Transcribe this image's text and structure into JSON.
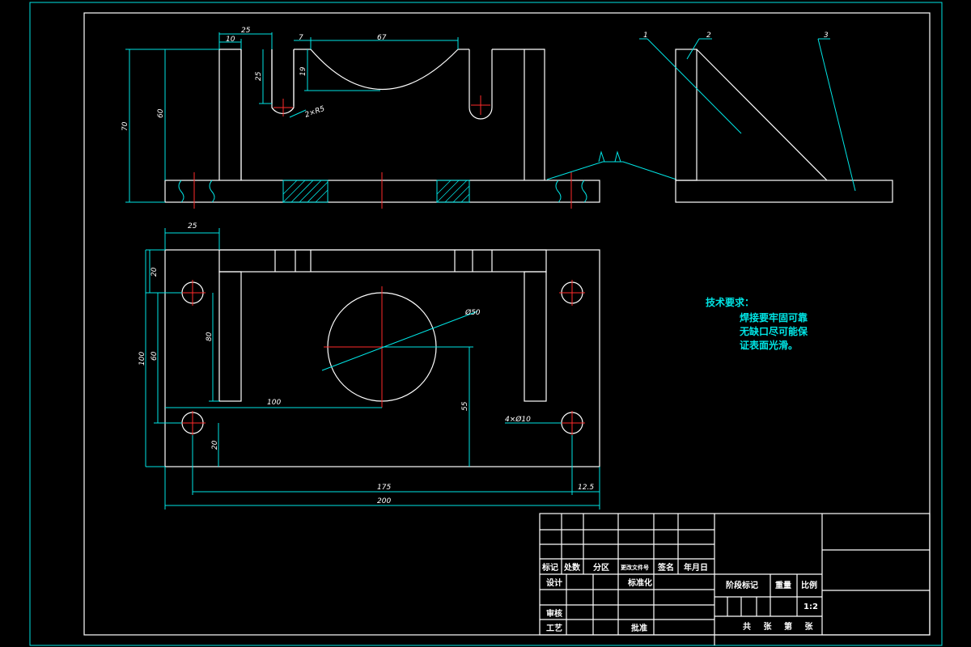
{
  "dimensions": {
    "d25_top": "25",
    "d10": "10",
    "d7": "7",
    "d67": "67",
    "d25_side": "25",
    "d19": "19",
    "d70": "70",
    "d60_front": "60",
    "d2xR5": "2×R5",
    "d25_plan": "25",
    "d20_top": "20",
    "d60_left": "60",
    "d100_left": "100",
    "d80": "80",
    "d50": "Ø50",
    "d100_mid": "100",
    "d55": "55",
    "d4x10": "4×Ø10",
    "d20_bottom": "20",
    "d175": "175",
    "d12_5": "12.5",
    "d200": "200"
  },
  "balloons": [
    "1",
    "2",
    "3"
  ],
  "tech_requirements": {
    "title": "技术要求：",
    "lines": [
      "焊接要牢固可靠",
      "无缺口尽可能保",
      "证表面光滑。"
    ]
  },
  "title_block": {
    "biaoji": "标记",
    "chushu": "处数",
    "fenqu": "分区",
    "gengai": "更改文件号",
    "qianming": "签名",
    "nianyueri": "年月日",
    "sheji": "设计",
    "biaozhunhua": "标准化",
    "shenhe": "审核",
    "gongyi": "工艺",
    "pizhun": "批准",
    "jieduan": "阶段标记",
    "zhongliang": "重量",
    "bili": "比例",
    "scale": "1:2",
    "pages": "共 张 第 张"
  }
}
